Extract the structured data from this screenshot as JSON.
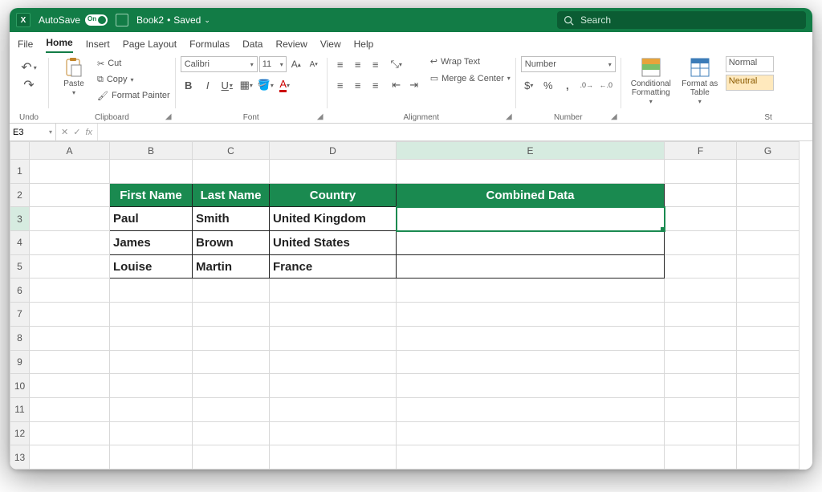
{
  "titlebar": {
    "product_glyph": "X",
    "autosave_label": "AutoSave",
    "autosave_on": "On",
    "filename": "Book2",
    "saved_state": "Saved",
    "search_placeholder": "Search"
  },
  "menu": {
    "file": "File",
    "home": "Home",
    "insert": "Insert",
    "page_layout": "Page Layout",
    "formulas": "Formulas",
    "data": "Data",
    "review": "Review",
    "view": "View",
    "help": "Help"
  },
  "ribbon": {
    "undo_group": "Undo",
    "clipboard": {
      "group": "Clipboard",
      "paste": "Paste",
      "cut": "Cut",
      "copy": "Copy",
      "format_painter": "Format Painter"
    },
    "font": {
      "group": "Font",
      "name": "Calibri",
      "size": "11",
      "bold": "B",
      "italic": "I",
      "underline": "U"
    },
    "alignment": {
      "group": "Alignment",
      "wrap": "Wrap Text",
      "merge": "Merge & Center"
    },
    "number": {
      "group": "Number",
      "format": "Number",
      "percent": "%",
      "comma": ","
    },
    "styles": {
      "cond": "Conditional Formatting",
      "fat": "Format as Table",
      "normal": "Normal",
      "neutral": "Neutral",
      "group": "St"
    }
  },
  "formula_bar": {
    "cell_ref": "E3",
    "fx": "fx",
    "value": ""
  },
  "columns": [
    "A",
    "B",
    "C",
    "D",
    "E",
    "F",
    "G"
  ],
  "rows": [
    "1",
    "2",
    "3",
    "4",
    "5",
    "6",
    "7",
    "8",
    "9",
    "10",
    "11",
    "12",
    "13"
  ],
  "table": {
    "headers": {
      "first_name": "First Name",
      "last_name": "Last Name",
      "country": "Country",
      "combined": "Combined Data"
    },
    "r1": {
      "first": "Paul",
      "last": "Smith",
      "country": "United Kingdom",
      "combined": ""
    },
    "r2": {
      "first": "James",
      "last": "Brown",
      "country": "United States",
      "combined": ""
    },
    "r3": {
      "first": "Louise",
      "last": "Martin",
      "country": "France",
      "combined": ""
    }
  },
  "selection": {
    "cell": "E3"
  }
}
